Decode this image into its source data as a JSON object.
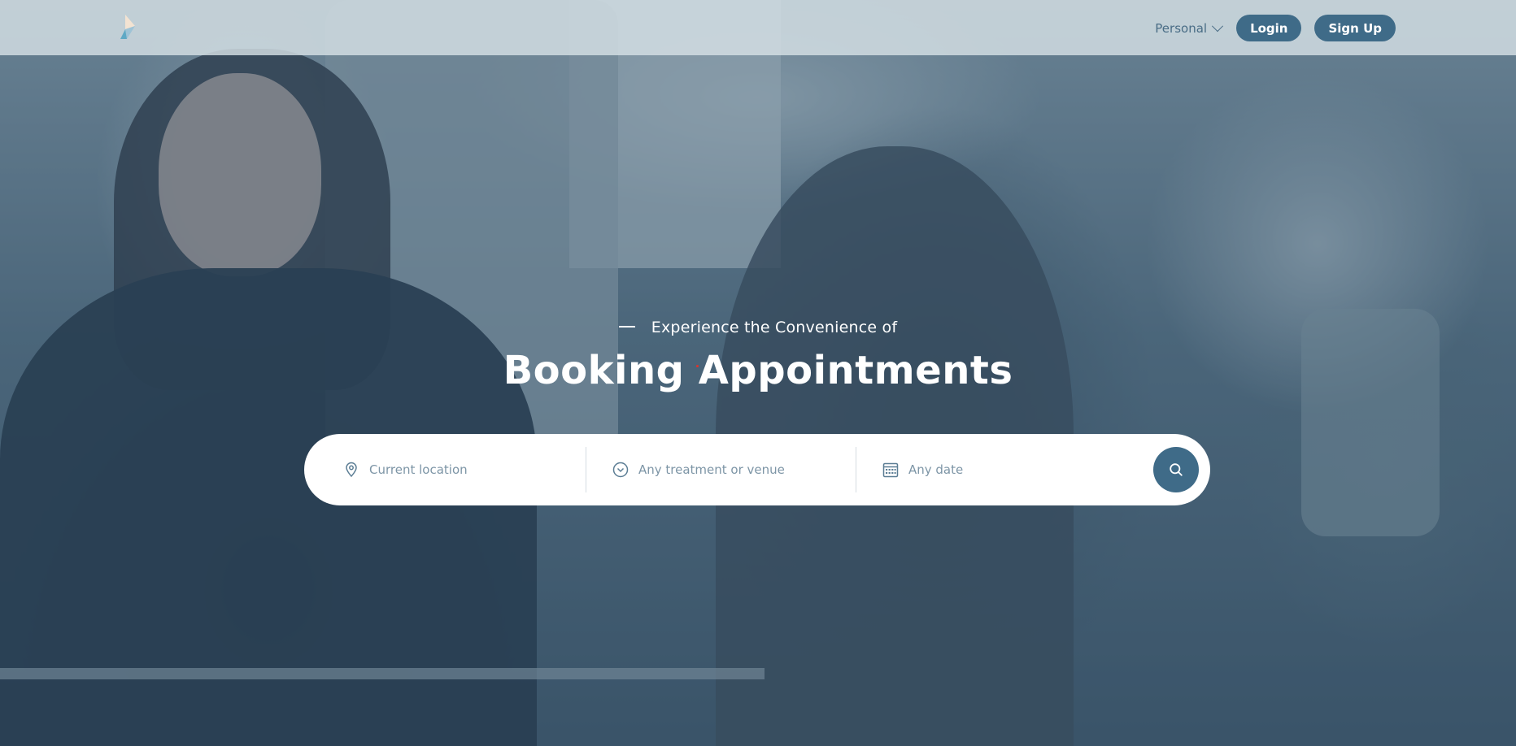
{
  "header": {
    "personal_label": "Personal",
    "login_label": "Login",
    "signup_label": "Sign Up"
  },
  "hero": {
    "subtitle": "Experience the Convenience of",
    "title": "Booking Appointments"
  },
  "search": {
    "location_placeholder": "Current location",
    "treatment_placeholder": "Any treatment or venue",
    "date_placeholder": "Any date"
  },
  "icons": {
    "logo": "brand-logo-icon",
    "personal_dropdown": "chevron-down-icon",
    "location": "map-pin-icon",
    "treatment": "chevron-circle-icon",
    "date": "calendar-icon",
    "search": "search-icon"
  },
  "colors": {
    "accent": "#3f6b88",
    "text_muted": "#7d95a6",
    "header_bg": "#d6e0e5",
    "overlay": "#34526a"
  }
}
